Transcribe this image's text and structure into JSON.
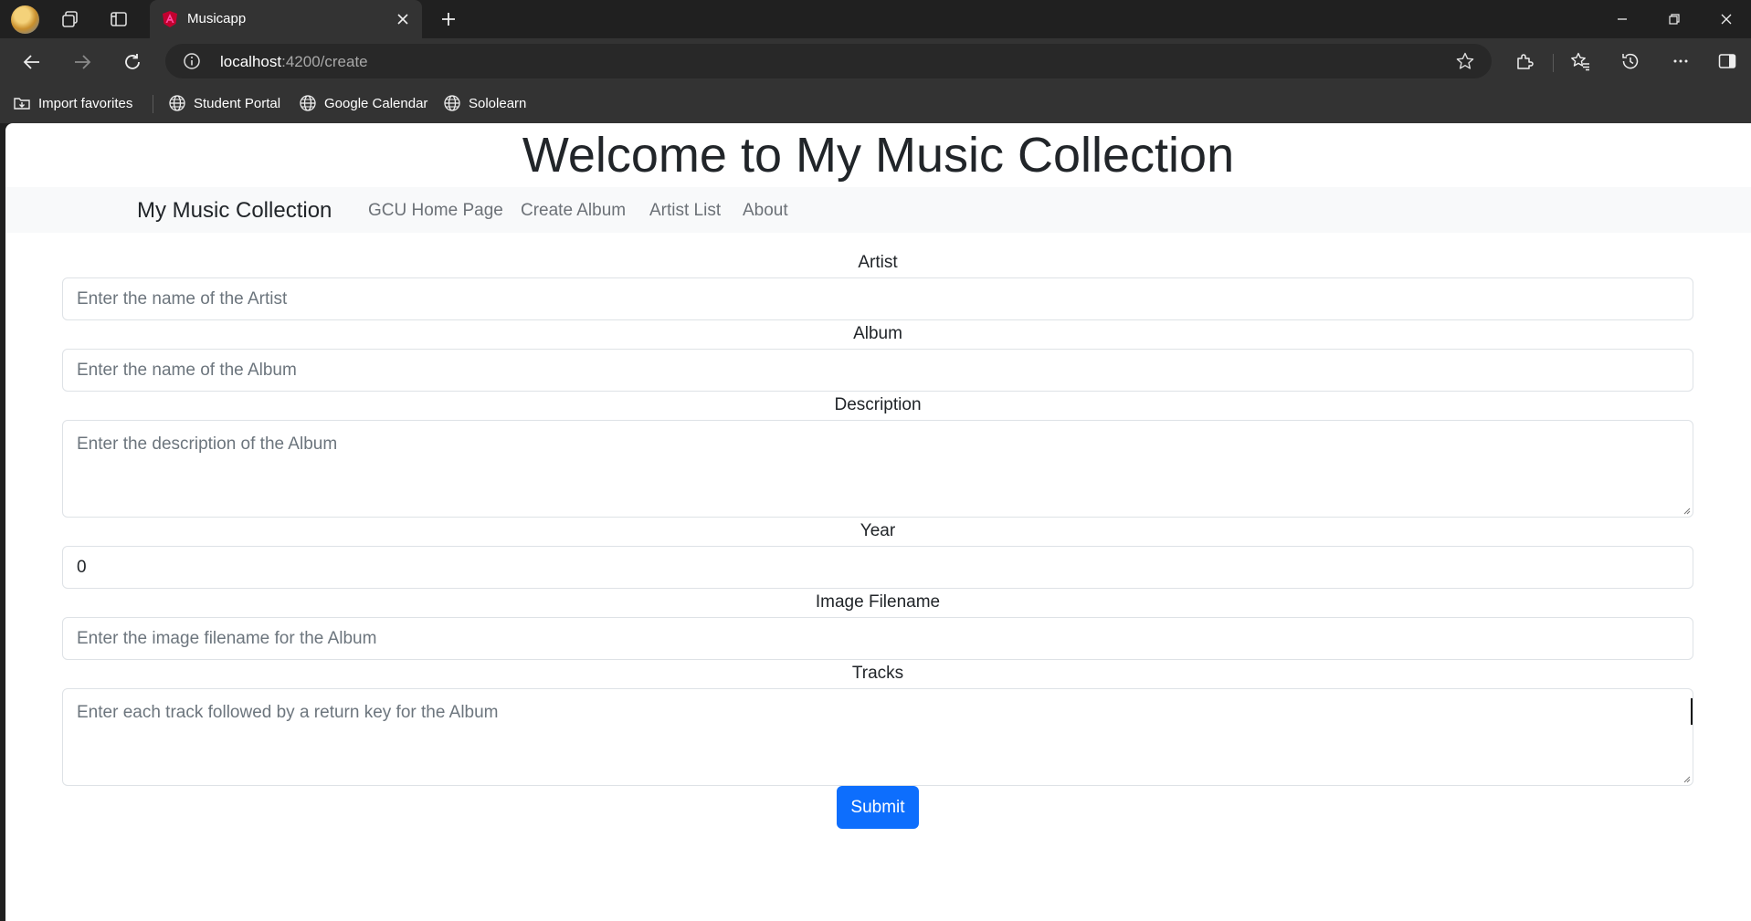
{
  "browser": {
    "tab_title": "Musicapp",
    "url_host": "localhost",
    "url_path": ":4200/create",
    "bookmarks": [
      {
        "label": "Import favorites",
        "icon": "import-icon"
      },
      {
        "label": "Student Portal",
        "icon": "globe-icon"
      },
      {
        "label": "Google Calendar",
        "icon": "globe-icon"
      },
      {
        "label": "Sololearn",
        "icon": "globe-icon"
      }
    ],
    "colors": {
      "chrome_dark": "#202020",
      "chrome": "#333333",
      "favicon": "#e0207a"
    }
  },
  "page": {
    "heading": "Welcome to My Music Collection",
    "navbar": {
      "brand": "My Music Collection",
      "links": [
        "GCU Home Page",
        "Create Album",
        "Artist List",
        "About"
      ]
    },
    "form": {
      "artist": {
        "label": "Artist",
        "placeholder": "Enter the name of the Artist"
      },
      "album": {
        "label": "Album",
        "placeholder": "Enter the name of the Album"
      },
      "description": {
        "label": "Description",
        "placeholder": "Enter the description of the Album"
      },
      "year": {
        "label": "Year",
        "value": "0"
      },
      "image": {
        "label": "Image Filename",
        "placeholder": "Enter the image filename for the Album"
      },
      "tracks": {
        "label": "Tracks",
        "placeholder": "Enter each track followed by a return key for the Album"
      },
      "submit_label": "Submit"
    },
    "colors": {
      "primary": "#0d6efd",
      "navbar_bg": "#f8f9fa",
      "text": "#212529"
    }
  }
}
